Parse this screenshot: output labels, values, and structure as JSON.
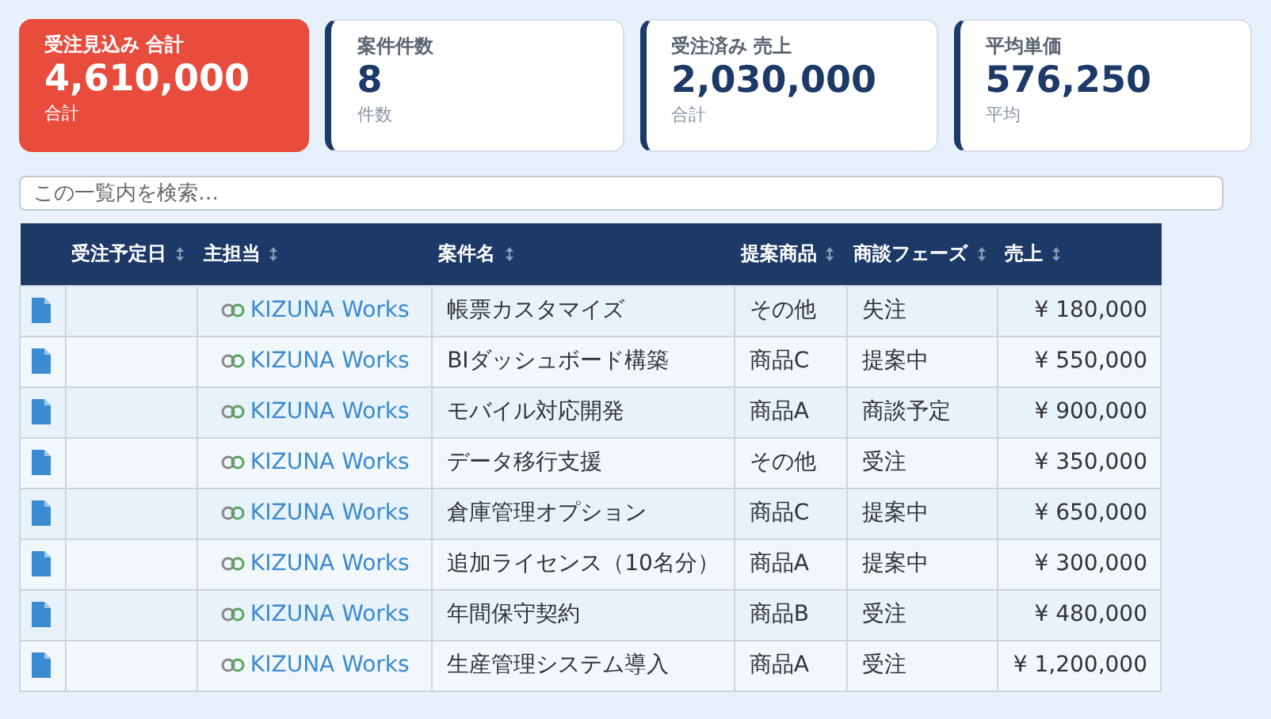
{
  "summary_cards": [
    {
      "title": "受注見込み 合計",
      "value": "4,610,000",
      "caption": "合計",
      "highlight": true
    },
    {
      "title": "案件件数",
      "value": "8",
      "caption": "件数",
      "highlight": false
    },
    {
      "title": "受注済み 売上",
      "value": "2,030,000",
      "caption": "合計",
      "highlight": false
    },
    {
      "title": "平均単価",
      "value": "576,250",
      "caption": "平均",
      "highlight": false
    }
  ],
  "search": {
    "placeholder": "この一覧内を検索…"
  },
  "table": {
    "columns": [
      {
        "label": "受注予定日",
        "sortable": true
      },
      {
        "label": "主担当",
        "sortable": true
      },
      {
        "label": "案件名",
        "sortable": true
      },
      {
        "label": "提案商品",
        "sortable": true
      },
      {
        "label": "商談フェーズ",
        "sortable": true
      },
      {
        "label": "売上",
        "sortable": true
      }
    ],
    "rows": [
      {
        "owner": "KIZUNA Works",
        "deal": "帳票カスタマイズ",
        "product": "その他",
        "phase": "失注",
        "sales": "¥ 180,000"
      },
      {
        "owner": "KIZUNA Works",
        "deal": "BIダッシュボード構築",
        "product": "商品C",
        "phase": "提案中",
        "sales": "¥ 550,000"
      },
      {
        "owner": "KIZUNA Works",
        "deal": "モバイル対応開発",
        "product": "商品A",
        "phase": "商談予定",
        "sales": "¥ 900,000"
      },
      {
        "owner": "KIZUNA Works",
        "deal": "データ移行支援",
        "product": "その他",
        "phase": "受注",
        "sales": "¥ 350,000"
      },
      {
        "owner": "KIZUNA Works",
        "deal": "倉庫管理オプション",
        "product": "商品C",
        "phase": "提案中",
        "sales": "¥ 650,000"
      },
      {
        "owner": "KIZUNA Works",
        "deal": "追加ライセンス（10名分）",
        "product": "商品A",
        "phase": "提案中",
        "sales": "¥ 300,000"
      },
      {
        "owner": "KIZUNA Works",
        "deal": "年間保守契約",
        "product": "商品B",
        "phase": "受注",
        "sales": "¥ 480,000"
      },
      {
        "owner": "KIZUNA Works",
        "deal": "生産管理システム導入",
        "product": "商品A",
        "phase": "受注",
        "sales": "¥ 1,200,000"
      }
    ]
  }
}
